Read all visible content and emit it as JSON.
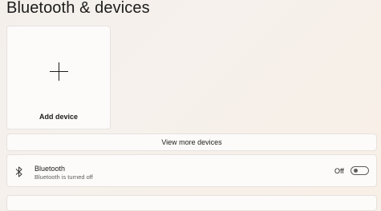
{
  "page": {
    "title": "Bluetooth & devices"
  },
  "add_device": {
    "label": "Add device",
    "icon": "plus-icon"
  },
  "view_more": {
    "label": "View more devices"
  },
  "bluetooth": {
    "icon": "bluetooth-icon",
    "title": "Bluetooth",
    "subtitle": "Bluetooth is turned off",
    "state_label": "Off",
    "enabled": false
  },
  "colors": {
    "background": "#f5f0eb",
    "card": "#fcfbfa",
    "card_border": "#e6e2de",
    "text": "#1c1c1c",
    "secondary_text": "#5f5f5f",
    "toggle_off": "#5c5c5c"
  }
}
